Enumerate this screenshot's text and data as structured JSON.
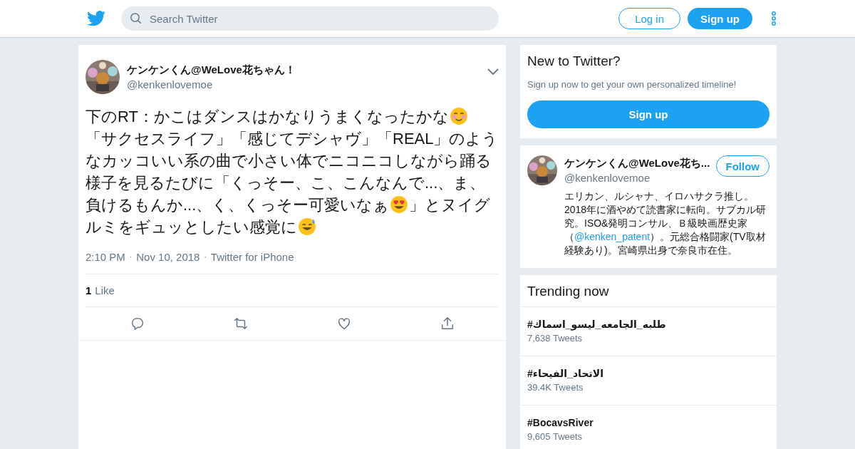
{
  "header": {
    "search": {
      "placeholder": "Search Twitter"
    },
    "login": "Log in",
    "signup": "Sign up"
  },
  "tweet": {
    "name": "ケンケンくん@WeLove花ちゃん！",
    "handle": "@kenkenlovemoe",
    "text": [
      {
        "kind": "text",
        "text": "下のRT：かこはダンスはかなりうまくなったかな"
      },
      {
        "kind": "blush"
      },
      {
        "kind": "text",
        "text": "「サクセスライフ」「感じてデシャヴ」「REAL」のようなカッコいい系の曲で小さい体でニコニコしながら踊る様子を見るたびに「くっそー、こ、こんなんで...、ま、負けるもんか...、く、くっそー可愛いなぁ"
      },
      {
        "kind": "heart-eyes"
      },
      {
        "kind": "text",
        "text": "」とヌイグルミをギュッとしたい感覚に"
      },
      {
        "kind": "sweat-smile"
      }
    ],
    "separator": "·",
    "time": "2:10 PM",
    "date": "Nov 10, 2018",
    "source": "Twitter for iPhone",
    "like_count": "1",
    "like_label": "Like"
  },
  "signup_card": {
    "title": "New to Twitter?",
    "subtitle": "Sign up now to get your own personalized timeline!",
    "button": "Sign up"
  },
  "profile_card": {
    "name": "ケンケンくん@WeLove花ち...",
    "handle": "@kenkenlovemoe",
    "follow": "Follow",
    "bio": [
      {
        "kind": "text",
        "text": "エリカン、ルシャナ、イロハサクラ推し。2018年に酒やめて読書家に転向。サブカル研究。ISO&発明コンサル、Ｂ級映画歴史家（"
      },
      {
        "kind": "link",
        "text": "@kenken_patent"
      },
      {
        "kind": "text",
        "text": "）。元総合格闘家(TV取材経験あり)。宮崎県出身で奈良市在住。"
      }
    ]
  },
  "trending": {
    "title": "Trending now",
    "items": [
      {
        "tag": "#طلبه_الجامعه_ليسو_اسماك",
        "count": "7,638 Tweets"
      },
      {
        "tag": "#الاتحاد_الفيحاء",
        "count": "39.4K Tweets"
      },
      {
        "tag": "#BocavsRiver",
        "count": "9,605 Tweets"
      }
    ]
  }
}
